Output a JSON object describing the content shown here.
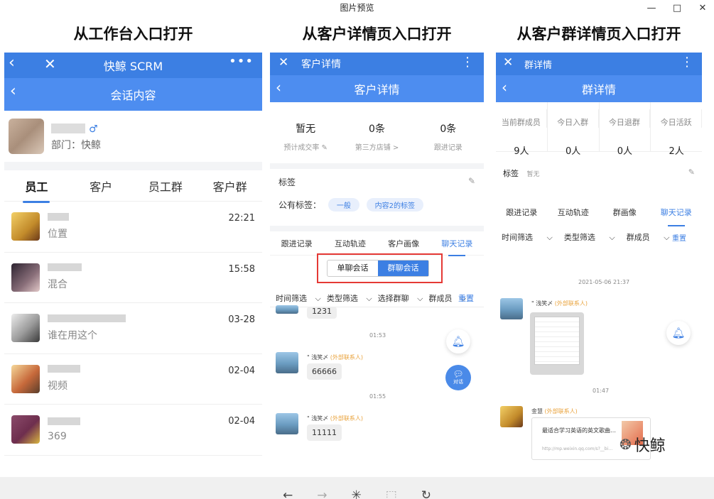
{
  "window": {
    "title": "图片预览",
    "controls": [
      "—",
      "□",
      "✕"
    ]
  },
  "headings": [
    "从工作台入口打开",
    "从客户详情页入口打开",
    "从客户群详情页入口打开"
  ],
  "panel1": {
    "app_title": "快鲸 SCRM",
    "page_title": "会话内容",
    "profile": {
      "gender": "♂",
      "dept": "部门：快鲸"
    },
    "tabs": [
      "员工",
      "客户",
      "员工群",
      "客户群"
    ],
    "active_tab": "员工",
    "conversations": [
      {
        "sub": "位置",
        "time": "22:21"
      },
      {
        "sub": "混合",
        "time": "15:58"
      },
      {
        "sub": "谁在用这个",
        "time": "03-28"
      },
      {
        "sub": "视频",
        "time": "02-04"
      },
      {
        "sub": "369",
        "time": "02-04"
      }
    ]
  },
  "panel2": {
    "nav_title": "客户详情",
    "page_title": "客户详情",
    "stats": [
      {
        "value": "暂无",
        "label": "预计成交率 ✎"
      },
      {
        "value": "0条",
        "label": "第三方店铺 >"
      },
      {
        "value": "0条",
        "label": "跟进记录"
      }
    ],
    "tags_title": "标签",
    "public_tags_label": "公有标签：",
    "tags": [
      "一般",
      "内容2的标签"
    ],
    "tabs": [
      "跟进记录",
      "互动轨迹",
      "客户画像",
      "聊天记录"
    ],
    "active_tab": "聊天记录",
    "segments": [
      "单聊会话",
      "群聊会话"
    ],
    "active_segment": "群聊会话",
    "filters": [
      "时间筛选",
      "类型筛选",
      "选择群聊",
      "群成员"
    ],
    "reset": "重置",
    "messages": {
      "partial": "1231",
      "time1": "01:53",
      "sender": "浅笑〆",
      "sender_tag": "(外部联系人)",
      "msg1": "66666",
      "time2": "01:55",
      "msg2": "11111"
    },
    "fab_label": "对话"
  },
  "panel3": {
    "nav_title": "群详情",
    "page_title": "群详情",
    "stats": [
      {
        "label": "当前群成员",
        "value": "9人"
      },
      {
        "label": "今日入群",
        "value": "0人"
      },
      {
        "label": "今日退群",
        "value": "0人"
      },
      {
        "label": "今日活跃",
        "value": "2人"
      }
    ],
    "tags_title": "标签",
    "tags_value": "暂无",
    "tabs": [
      "跟进记录",
      "互动轨迹",
      "群画像",
      "聊天记录"
    ],
    "active_tab": "聊天记录",
    "filters": [
      "时间筛选",
      "类型筛选",
      "群成员"
    ],
    "reset": "重置",
    "date": "2021-05-06 21:37",
    "sender1": "浅笑〆",
    "sender1_tag": "(外部联系人)",
    "time2": "01:47",
    "sender2": "金慧",
    "sender2_tag": "(外部联系人)",
    "card_title": "最适合学习英语的英文歌曲…",
    "card_url": "http://mp.weixin.qq.com/s?__bi…"
  },
  "watermark": "快鲸",
  "bottom_toolbar": [
    "←",
    "→",
    "✳",
    "⬚",
    "↻"
  ],
  "colors": {
    "primary": "#3c7fe3",
    "accent_red": "#e53935",
    "orange": "#e9a23b"
  }
}
